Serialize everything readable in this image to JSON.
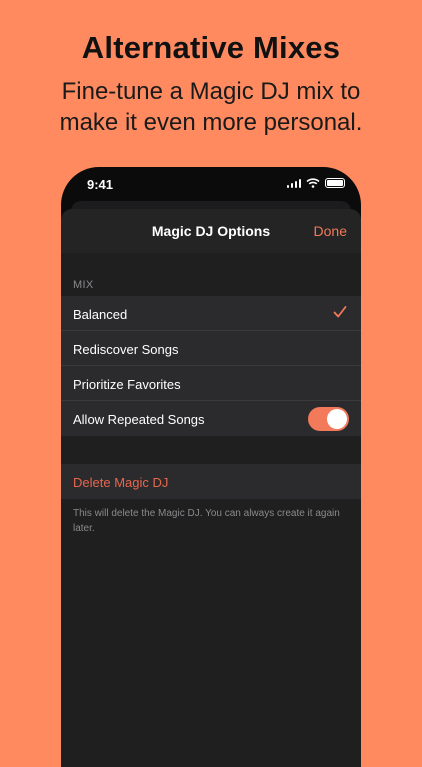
{
  "promo": {
    "headline": "Alternative Mixes",
    "subhead_line1": "Fine-tune a Magic DJ mix to",
    "subhead_line2": "make it even more personal."
  },
  "status_bar": {
    "time": "9:41"
  },
  "sheet": {
    "title": "Magic DJ Options",
    "done_label": "Done",
    "section_header": "MIX",
    "options": [
      {
        "label": "Balanced",
        "selected": true
      },
      {
        "label": "Rediscover Songs",
        "selected": false
      },
      {
        "label": "Prioritize Favorites",
        "selected": false
      }
    ],
    "toggle_row": {
      "label": "Allow Repeated Songs",
      "on": true
    },
    "delete_label": "Delete Magic DJ",
    "footnote": "This will delete the Magic DJ. You can always create it again later."
  },
  "colors": {
    "background": "#FF8A5F",
    "accent": "#F2795A",
    "destructive": "#E5674E"
  }
}
